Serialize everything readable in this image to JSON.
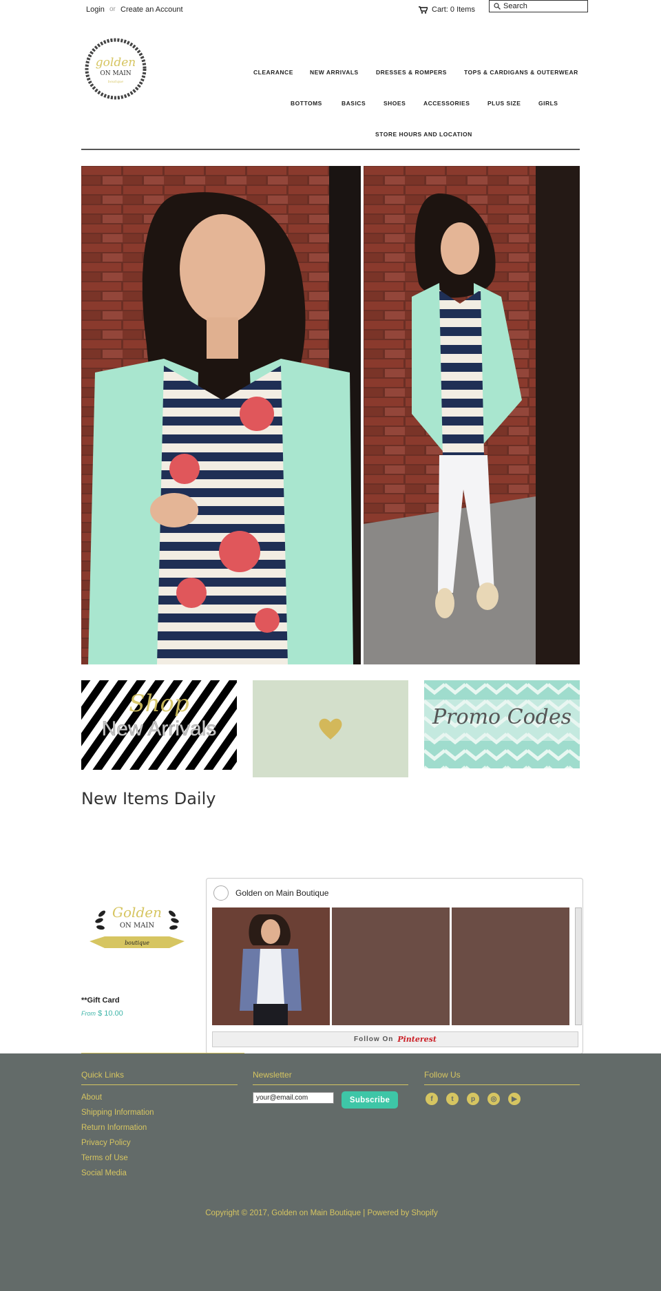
{
  "topbar": {
    "login": "Login",
    "or": "or",
    "create_account": "Create an Account",
    "cart": "Cart: 0 Items",
    "search_placeholder": "Search"
  },
  "logo": {
    "line1": "golden",
    "line2": "ON MAIN",
    "line3": "boutique"
  },
  "nav": {
    "row1": [
      "CLEARANCE",
      "NEW ARRIVALS",
      "DRESSES & ROMPERS",
      "TOPS & CARDIGANS & OUTERWEAR"
    ],
    "row2": [
      "BOTTOMS",
      "BASICS",
      "SHOES",
      "ACCESSORIES",
      "PLUS SIZE",
      "GIRLS"
    ],
    "row3": [
      "STORE HOURS AND LOCATION"
    ]
  },
  "promos": {
    "shop_line1": "Shop",
    "shop_line2": "New Arrivals",
    "promo_codes": "Promo Codes"
  },
  "section_title": "New Items Daily",
  "product": {
    "logo_line1": "Golden",
    "logo_line2": "ON MAIN",
    "logo_ribbon": "boutique",
    "name": "**Gift Card",
    "from": "From",
    "price": "$ 10.00"
  },
  "pinterest": {
    "title": "Golden on Main Boutique",
    "follow_on": "Follow On",
    "brand": "Pinterest"
  },
  "footer": {
    "quick_links_heading": "Quick Links",
    "links": [
      "About",
      "Shipping Information",
      "Return Information",
      "Privacy Policy",
      "Terms of Use",
      "Social Media"
    ],
    "newsletter_heading": "Newsletter",
    "newsletter_value": "your@email.com",
    "subscribe": "Subscribe",
    "follow_heading": "Follow Us",
    "social_icons": [
      "facebook-icon",
      "twitter-icon",
      "pinterest-icon",
      "instagram-icon",
      "youtube-icon"
    ],
    "copyright": "Copyright © 2017, Golden on Main Boutique | Powered by Shopify"
  },
  "colors": {
    "gold": "#d6c561",
    "footer_bg": "#636b69",
    "teal": "#3ec6a7",
    "mint": "#a9e6cf"
  }
}
